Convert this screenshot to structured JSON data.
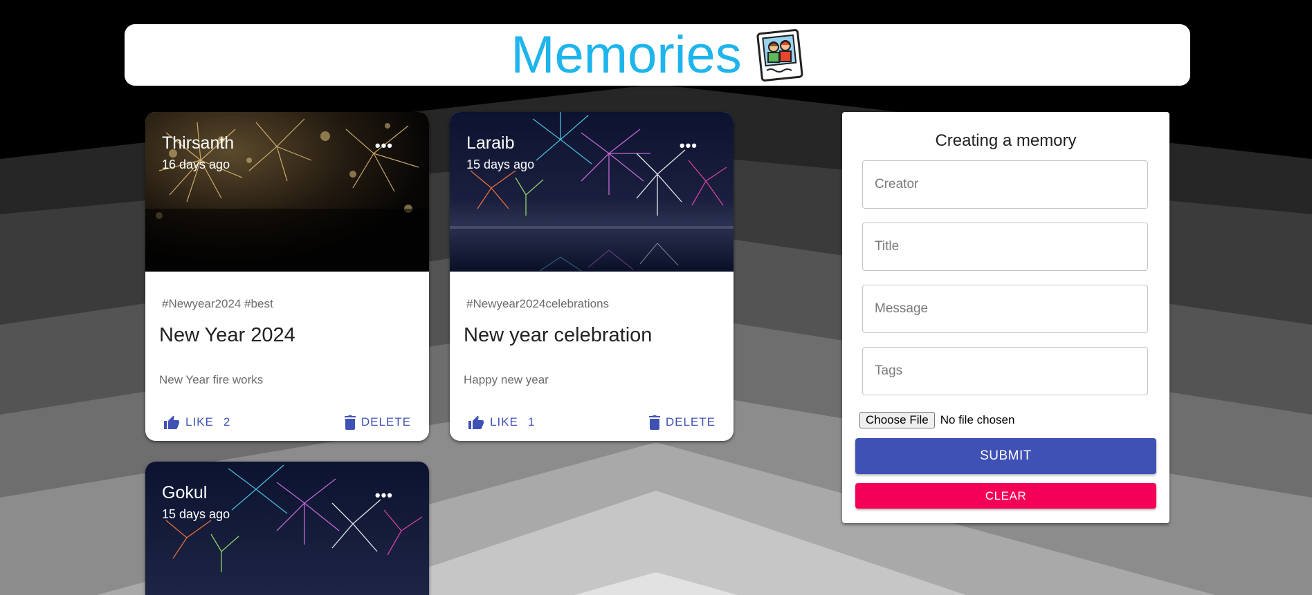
{
  "app": {
    "title": "Memories",
    "logo_icon": "photo-frame-icon",
    "brand_color": "#1eb4ec"
  },
  "posts": [
    {
      "creator": "Thirsanth",
      "time": "16 days ago",
      "tags": "#Newyear2024 #best",
      "title": "New Year 2024",
      "message": "New Year fire works",
      "like_label": "LIKE",
      "like_count": "2",
      "delete_label": "DELETE",
      "image": "fireworks-gold-image"
    },
    {
      "creator": "Laraib",
      "time": "15 days ago",
      "tags": "#Newyear2024celebrations",
      "title": "New year celebration",
      "message": "Happy new year",
      "like_label": "LIKE",
      "like_count": "1",
      "delete_label": "DELETE",
      "image": "fireworks-colorful-image"
    },
    {
      "creator": "Gokul",
      "time": "15 days ago",
      "image": "fireworks-colorful-image"
    }
  ],
  "form": {
    "heading": "Creating a memory",
    "creator_placeholder": "Creator",
    "title_placeholder": "Title",
    "message_placeholder": "Message",
    "tags_placeholder": "Tags",
    "file_button": "Choose File",
    "file_status": "No file chosen",
    "submit_label": "SUBMIT",
    "clear_label": "CLEAR"
  },
  "colors": {
    "primary": "#3f51b5",
    "secondary": "#f50057",
    "more_menu": "more-horizontal-icon"
  }
}
